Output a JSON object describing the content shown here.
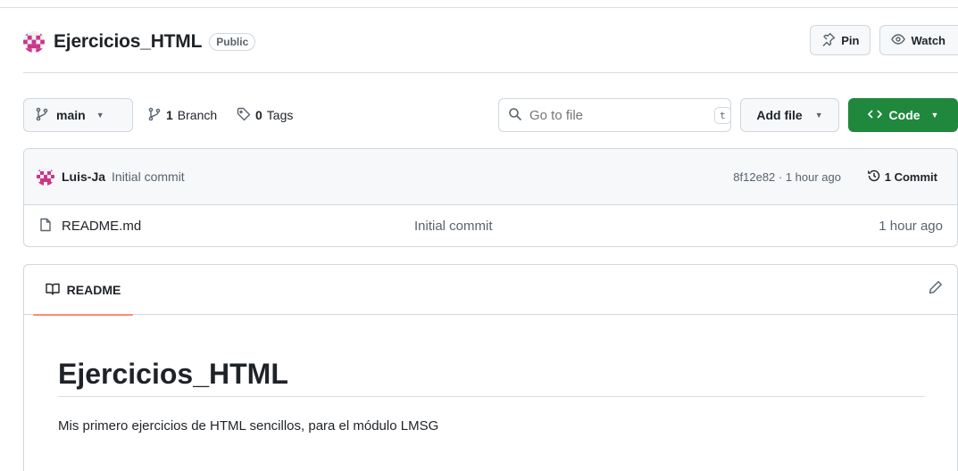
{
  "repo": {
    "name": "Ejercicios_HTML",
    "visibility": "Public",
    "avatar_icon": "identicon-avatar",
    "actions": [
      {
        "label": "Pin",
        "icon": "pin-icon"
      },
      {
        "label": "Watch",
        "icon": "eye-icon"
      }
    ]
  },
  "toolbar": {
    "branch": "main",
    "branches_count": "1",
    "branches_label": "Branch",
    "tags_count": "0",
    "tags_label": "Tags",
    "search_placeholder": "Go to file",
    "search_shortcut": "t",
    "add_file_label": "Add file",
    "code_label": "Code"
  },
  "latest_commit": {
    "author": "Luis-Ja",
    "message": "Initial commit",
    "meta": "8f12e82 · 1 hour ago",
    "count_label": "1 Commit"
  },
  "files": [
    {
      "name": "README.md",
      "commit": "Initial commit",
      "date": "1 hour ago",
      "icon": "file-icon"
    }
  ],
  "readme": {
    "tab_label": "README",
    "heading": "Ejercicios_HTML",
    "paragraph": "Mis primero ejercicios de HTML sencillos, para el módulo LMSG"
  },
  "colors": {
    "accent_green": "#1f883d",
    "tab_underline": "#fd8c73",
    "identicon": "#c9378a"
  }
}
